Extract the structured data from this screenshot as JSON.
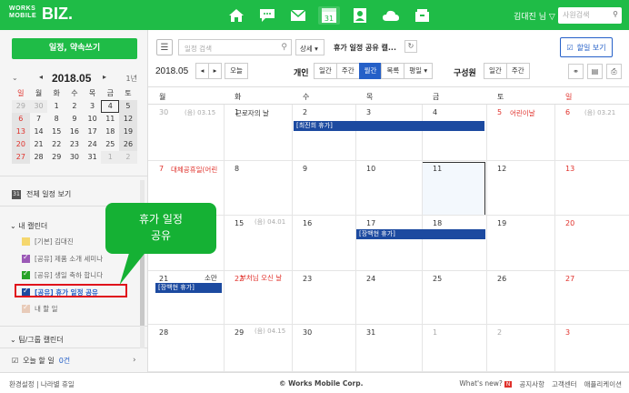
{
  "topbar": {
    "logo_small": "WORKS\nMOBILE",
    "logo_big": "BIZ.",
    "user": "김대진 님 ▽",
    "search_placeholder": "사원검색",
    "apps": [
      "home-icon",
      "chat-icon",
      "mail-icon",
      "calendar-icon",
      "contacts-icon",
      "cloud-icon",
      "store-icon"
    ],
    "calendar_day": "31",
    "colors": {
      "brand": "#1fbc47"
    }
  },
  "sidebar": {
    "new_button": "일정, 약속쓰기",
    "mini_year_month": "2018.05",
    "mini_year": "1년",
    "weekdays": [
      "일",
      "월",
      "화",
      "수",
      "목",
      "금",
      "토"
    ],
    "weeks": [
      [
        "29",
        "30",
        "1",
        "2",
        "3",
        "4",
        "5"
      ],
      [
        "6",
        "7",
        "8",
        "9",
        "10",
        "11",
        "12"
      ],
      [
        "13",
        "14",
        "15",
        "16",
        "17",
        "18",
        "19"
      ],
      [
        "20",
        "21",
        "22",
        "23",
        "24",
        "25",
        "26"
      ],
      [
        "27",
        "28",
        "29",
        "30",
        "31",
        "1",
        "2"
      ]
    ],
    "all_view": "전체 일정 보기",
    "my_calendar_title": "내 캘린더",
    "calendars": [
      {
        "label": "[기본] 김대진",
        "color": "#f5d76e",
        "checked": false
      },
      {
        "label": "[공유] 제품 소개 세미나",
        "color": "#9b59b6",
        "checked": true
      },
      {
        "label": "[공유] 생일 축하 합니다",
        "color": "#27a327",
        "checked": true
      },
      {
        "label": "[공유] 휴가 일정 공유",
        "color": "#1c4aa0",
        "checked": true
      },
      {
        "label": "내 할 일",
        "color": "#e8cbb9",
        "checked": true
      }
    ],
    "team_title": "팀/그룹 캘린더",
    "todo_label": "오늘 할 일",
    "todo_count": "0건"
  },
  "toolbar": {
    "search_placeholder": "일정 검색",
    "detail": "상세 ▾",
    "shared_title": "휴가 일정 공유 캘...",
    "todo_view": "할일 보기",
    "month_label": "2018.05",
    "today": "오늘",
    "personal": "개인",
    "personal_views": [
      "일간",
      "주간",
      "월간",
      "목록",
      "평일 ▾"
    ],
    "member": "구성원",
    "member_views": [
      "일간",
      "주간"
    ]
  },
  "calendar": {
    "daynames": [
      "월",
      "화",
      "수",
      "목",
      "금",
      "토",
      "일"
    ],
    "weeks": [
      [
        "30",
        "1",
        "2",
        "3",
        "4",
        "5",
        "6"
      ],
      [
        "7",
        "8",
        "9",
        "10",
        "11",
        "12",
        "13"
      ],
      [
        "14",
        "15",
        "16",
        "17",
        "18",
        "19",
        "20"
      ],
      [
        "21",
        "22",
        "23",
        "24",
        "25",
        "26",
        "27"
      ],
      [
        "28",
        "29",
        "30",
        "31",
        "1",
        "2",
        "3"
      ]
    ],
    "lunar_w1_mon": "(음) 03.15",
    "lunar_w1_sun": "(음) 03.21",
    "lunar_w3_mon": "(음) 04.01",
    "lunar_w5_tue": "(음) 04.15",
    "memo_w1_tue": "근로자의 날",
    "holiday_w1_sat": "어린이날",
    "holiday_w2_mon": "대체공휴일(어린",
    "holiday_w4_tue": "부처님 오신 날",
    "holiday_w4_mon": "소만",
    "event_w1": "[최진희 휴가]",
    "event_w3": "[장백현 휴가]",
    "event_w4": "[장백현 휴가]"
  },
  "callout": {
    "line1": "휴가 일정",
    "line2": "공유"
  },
  "bottombar": {
    "left": "환경설정 | 나라별 휴일",
    "center": "© Works Mobile Corp.",
    "whatsnew": "What's new?",
    "new_badge": "N",
    "notice": "공지사항",
    "customer": "고객센터",
    "app": "애플리케이션"
  }
}
